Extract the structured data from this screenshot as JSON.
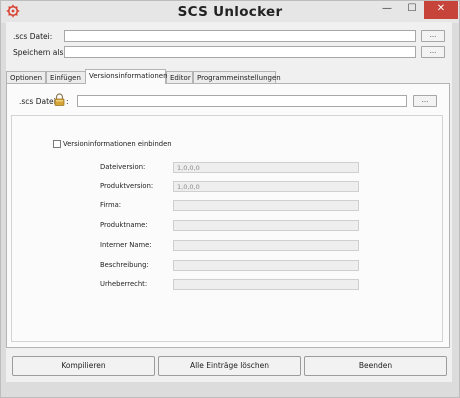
{
  "window": {
    "title": "SCS Unlocker",
    "controls": {
      "minimize": "—",
      "maximize": "☐",
      "close": "✕"
    },
    "icon": "gear-logo-icon"
  },
  "source": {
    "label": ".scs Datei:",
    "value": "",
    "browse": "..."
  },
  "saveas": {
    "label": "Speichern als:",
    "value": "",
    "browse": "..."
  },
  "tabs": [
    {
      "label": "Optionen"
    },
    {
      "label": "Einfügen"
    },
    {
      "label": "Versionsinformationen"
    },
    {
      "label": "Editor"
    },
    {
      "label": "Programmeinstellungen"
    }
  ],
  "active_tab": "Versionsinformationen",
  "versioninfo": {
    "scs_label": ".scs Datei",
    "scs_suffix": ":",
    "lock_icon": "padlock-icon",
    "scs_value": "",
    "browse": "...",
    "checkbox_label": "Versioninformationen einbinden",
    "checkbox_checked": false,
    "fields": [
      {
        "label": "Dateiversion:",
        "value": "1,0,0,0"
      },
      {
        "label": "Produktversion:",
        "value": "1,0,0,0"
      },
      {
        "label": "Firma:",
        "value": ""
      },
      {
        "label": "Produktname:",
        "value": ""
      },
      {
        "label": "Interner Name:",
        "value": ""
      },
      {
        "label": "Beschreibung:",
        "value": ""
      },
      {
        "label": "Urheberrecht:",
        "value": ""
      }
    ]
  },
  "buttons": {
    "compile": "Kompilieren",
    "clear": "Alle Einträge löschen",
    "exit": "Beenden"
  },
  "colors": {
    "close_button": "#c7443a",
    "logo": "#d9402f"
  }
}
